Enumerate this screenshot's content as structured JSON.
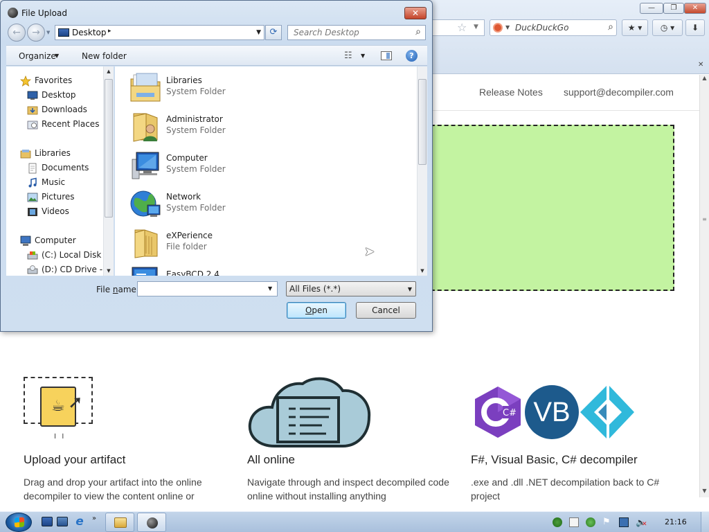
{
  "browser": {
    "search": {
      "engine": "DuckDuckGo",
      "placeholder": "DuckDuckGo"
    },
    "site": {
      "nav": {
        "release_notes": "Release Notes",
        "support": "support@decompiler.com"
      },
      "drop_zone_color": "#c3f3a1",
      "features": [
        {
          "title": "Upload your artifact",
          "desc": "Drag and drop your artifact into the online decompiler to view the content online or"
        },
        {
          "title": "All online",
          "desc": "Navigate through and inspect decompiled code online without installing anything"
        },
        {
          "title": "F#, Visual Basic, C# decompiler",
          "desc": ".exe and .dll .NET decompilation back to C# project"
        }
      ],
      "lang_icons": {
        "csharp": "C#",
        "vb": "VB",
        "fsharp": ""
      }
    }
  },
  "dialog": {
    "title": "File Upload",
    "close_label": "✕",
    "address": {
      "location": "Desktop",
      "separator": "▸"
    },
    "search_placeholder": "Search Desktop",
    "commands": {
      "organize": "Organize",
      "new_folder": "New folder"
    },
    "nav_pane": {
      "items": [
        {
          "label": "Favorites",
          "icon": "star-icon",
          "level": 0
        },
        {
          "label": "Desktop",
          "icon": "desktop-icon",
          "level": 1
        },
        {
          "label": "Downloads",
          "icon": "downloads-folder-icon",
          "level": 1
        },
        {
          "label": "Recent Places",
          "icon": "recent-places-icon",
          "level": 1
        },
        {
          "label": "Libraries",
          "icon": "libraries-icon",
          "level": 0
        },
        {
          "label": "Documents",
          "icon": "documents-icon",
          "level": 1
        },
        {
          "label": "Music",
          "icon": "music-icon",
          "level": 1
        },
        {
          "label": "Pictures",
          "icon": "pictures-icon",
          "level": 1
        },
        {
          "label": "Videos",
          "icon": "videos-icon",
          "level": 1
        },
        {
          "label": "Computer",
          "icon": "computer-icon",
          "level": 0
        },
        {
          "label": "(C:) Local Disk",
          "icon": "local-disk-icon",
          "level": 1
        },
        {
          "label": "(D:) CD Drive - Cl",
          "icon": "cd-drive-icon",
          "level": 1
        }
      ]
    },
    "files": [
      {
        "name": "Libraries",
        "type": "System Folder",
        "icon": "libraries-folder-icon"
      },
      {
        "name": "Administrator",
        "type": "System Folder",
        "icon": "user-folder-icon"
      },
      {
        "name": "Computer",
        "type": "System Folder",
        "icon": "computer-icon"
      },
      {
        "name": "Network",
        "type": "System Folder",
        "icon": "network-icon"
      },
      {
        "name": "eXPerience",
        "type": "File folder",
        "icon": "folder-icon"
      },
      {
        "name": "EasyBCD 2.4",
        "type": "",
        "icon": "shortcut-icon"
      }
    ],
    "file_name": {
      "label_pre": "File ",
      "label_u": "n",
      "label_post": "ame:",
      "value": ""
    },
    "file_type": "All Files (*.*)",
    "buttons": {
      "open_u": "O",
      "open_rest": "pen",
      "cancel": "Cancel"
    }
  },
  "taskbar": {
    "clock": "21:16",
    "quick_launch_more": "»"
  },
  "colors": {
    "dialog_close": "#c4442a",
    "accent_blue": "#1d5a8c",
    "drop_zone": "#c3f3a1",
    "java_file": "#f7d25c",
    "cloud_fill": "#a9cbd8"
  }
}
